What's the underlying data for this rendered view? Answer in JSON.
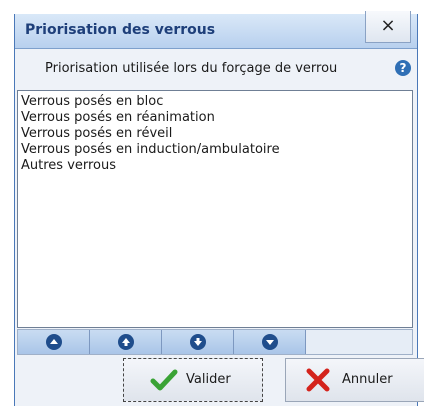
{
  "window": {
    "title": "Priorisation des verrous",
    "close_label": "×"
  },
  "header": {
    "subtitle": "Priorisation utilisée lors du forçage de verrou",
    "help_glyph": "?"
  },
  "list": {
    "items": [
      "Verrous posés en bloc",
      "Verrous posés en réanimation",
      "Verrous posés en réveil",
      "Verrous posés en induction/ambulatoire",
      "Autres verrous"
    ]
  },
  "order_buttons": [
    {
      "icon": "move-to-top-icon",
      "glyph": "⏫"
    },
    {
      "icon": "move-up-icon",
      "glyph": "▲"
    },
    {
      "icon": "move-down-icon",
      "glyph": "▼"
    },
    {
      "icon": "move-to-bottom-icon",
      "glyph": "⏬"
    }
  ],
  "actions": {
    "validate_label": "Valider",
    "cancel_label": "Annuler"
  },
  "colors": {
    "title_text": "#1e3f7a",
    "accent": "#2f6fb5",
    "check": "#3aa335",
    "cross": "#d4231c"
  }
}
